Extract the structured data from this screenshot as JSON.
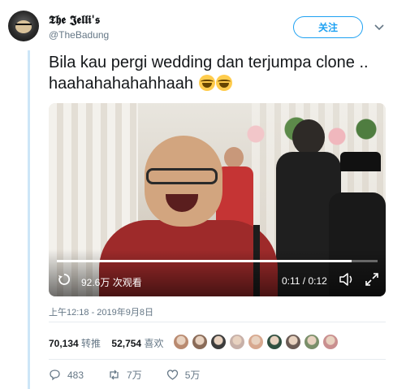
{
  "header": {
    "display_name": "𝕿𝖍𝖊 𝕵𝖊𝖑𝖑𝖎'𝖘",
    "handle": "@TheBadung",
    "follow_label": "关注"
  },
  "tweet": {
    "text": "Bila kau pergi wedding dan terjumpa clone .. haahahahahahhaah",
    "emojis": [
      "face-with-tears-of-joy",
      "face-with-tears-of-joy"
    ]
  },
  "video": {
    "views": "92.6万 次观看",
    "time": "0:11 / 0:12",
    "progress": 0.92
  },
  "meta": {
    "timestamp": "上午12:18 - 2019年9月8日"
  },
  "stats": {
    "retweets_count": "70,134",
    "retweets_label": "转推",
    "likes_count": "52,754",
    "likes_label": "喜欢",
    "liker_avatar_colors": [
      "#b98a70",
      "#8a6b58",
      "#3c3c3c",
      "#c7b0a8",
      "#d7a88f",
      "#2f4f3f",
      "#6b5b55",
      "#7a8f6a",
      "#c98f8f"
    ]
  },
  "actions": {
    "reply_count": "483",
    "retweet_count": "7万",
    "like_count": "5万"
  }
}
